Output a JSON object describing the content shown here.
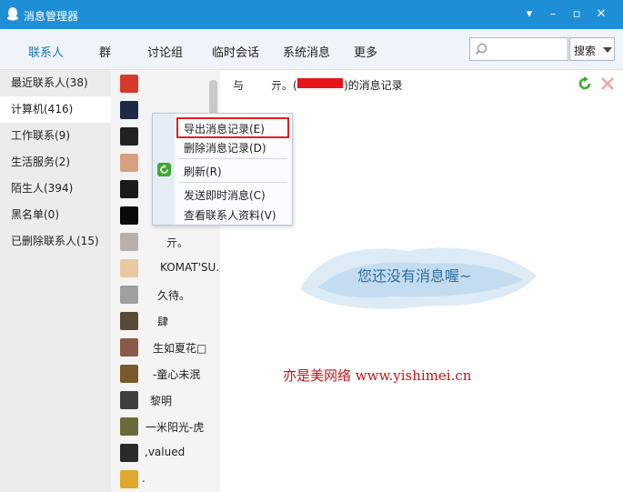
{
  "window": {
    "title": "消息管理器",
    "icon": "qq-penguin-icon"
  },
  "tabs": [
    {
      "label": "联系人",
      "active": true
    },
    {
      "label": "群"
    },
    {
      "label": "讨论组"
    },
    {
      "label": "临时会话"
    },
    {
      "label": "系统消息"
    },
    {
      "label": "更多"
    }
  ],
  "search": {
    "placeholder": "",
    "value": "",
    "button_label": "搜索"
  },
  "categories": [
    {
      "label": "最近联系人(38)"
    },
    {
      "label": "计算机(416)",
      "selected": true
    },
    {
      "label": "工作联系(9)"
    },
    {
      "label": "生活服务(2)"
    },
    {
      "label": "陌生人(394)"
    },
    {
      "label": "黑名单(0)"
    },
    {
      "label": "已删除联系人(15)"
    }
  ],
  "contacts": [
    {
      "name": "",
      "avatar_color": "#d63a2a"
    },
    {
      "name": "",
      "avatar_color": "#1c2a48"
    },
    {
      "name": "",
      "avatar_color": "#222222"
    },
    {
      "name": "",
      "avatar_color": "#d8a080"
    },
    {
      "name": "",
      "avatar_color": "#1a1a1a"
    },
    {
      "name": "",
      "avatar_color": "#0a0a0a"
    },
    {
      "name": "亓。",
      "avatar_color": "#b8b0a8"
    },
    {
      "name": "KOMAT'SU...",
      "avatar_color": "#e8c8a0"
    },
    {
      "name": "久待。",
      "avatar_color": "#a0a0a0"
    },
    {
      "name": "肆",
      "avatar_color": "#5a4a3a"
    },
    {
      "name": "生如夏花□",
      "avatar_color": "#8a5a4a"
    },
    {
      "name": "-童心未泯",
      "avatar_color": "#7a5a2a"
    },
    {
      "name": "黎明",
      "avatar_color": "#404040"
    },
    {
      "name": "一米阳光-虎",
      "avatar_color": "#6a6a3a"
    },
    {
      "name": ",valued",
      "avatar_color": "#2a2a2a"
    },
    {
      "name": ".",
      "avatar_color": "#e0a830"
    }
  ],
  "context_menu": {
    "items": [
      {
        "label": "导出消息记录(E)",
        "highlighted": true
      },
      {
        "label": "删除消息记录(D)"
      },
      {
        "label": "刷新(R)",
        "icon": "refresh-icon"
      },
      {
        "label": "发送即时消息(C)"
      },
      {
        "label": "查看联系人资料(V)"
      }
    ]
  },
  "history": {
    "prefix": "与",
    "contact": "亓。(",
    "suffix": ")的消息记录",
    "empty_text": "您还没有消息喔~"
  },
  "watermark": "亦是美网络 www.yishimei.cn",
  "colors": {
    "titlebar": "#1e8fd6",
    "active_tab": "#1a74c4",
    "highlight_border": "#e02020",
    "watermark": "#c81414",
    "empty_text": "#2e6ea2"
  }
}
